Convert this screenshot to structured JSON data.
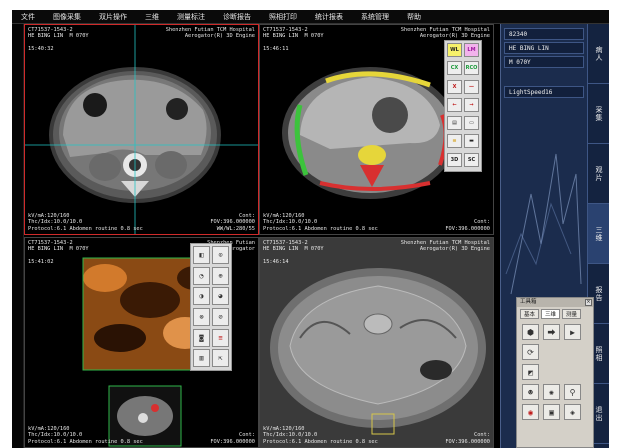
{
  "menu": [
    "文件",
    "图像采集",
    "双片操作",
    "三维",
    "测量标注",
    "诊断报告",
    "照相打印",
    "统计报表",
    "系统管理",
    "帮助"
  ],
  "viewports": {
    "vp1": {
      "top_left": "CT71537-1543-2\nHE BING LIN  M 070Y\n\n15:40:32",
      "top_right": "Shenzhen Futian TCM Hospital\nAerogator(R) 3D Engine",
      "bottom_left": "kV/mA:120/160\nThc/Idx:10.0/10.0\nProtocol:6.1 Abdomen routine 0.8 sec",
      "bottom_right": "Cont:\nFOV:396.000000\nWW/WL:280/55"
    },
    "vp2": {
      "top_left": "CT71537-1543-2\nHE BING LIN  M 070Y\n\n15:46:11",
      "top_right": "Shenzhen Futian TCM Hospital\nAerogator(R) 3D Engine",
      "bottom_left": "kV/mA:120/160\nThc/Idx:10.0/10.0\nProtocol:6.1 Abdomen routine 0.8 sec",
      "bottom_right": "Cont:\nFOV:396.000000"
    },
    "vp3": {
      "top_left": "CT71537-1543-2\nHE BING LIN  M 070Y\n\n15:41:02",
      "top_right": "Shenzhen Futian\nAerogator",
      "bottom_left": "kV/mA:120/160\nThc/Idx:10.0/10.0\nProtocol:6.1 Abdomen routine 0.8 sec",
      "bottom_right": "Cont:\nFOV:396.000000"
    },
    "vp4": {
      "top_left": "CT71537-1543-2\nHE BING LIN  M 070Y\n\n15:46:14",
      "top_right": "Shenzhen Futian TCM Hospital\nAerogator(R) 3D Engine",
      "bottom_left": "kV/mA:120/160\nThc/Idx:10.0/10.0\nProtocol:6.1 Abdomen routine 0.8 sec",
      "bottom_right": "Cont:\nFOV:396.000000"
    }
  },
  "tools2": [
    "WL",
    "LM",
    "CX",
    "RCO",
    "X",
    "—",
    "←",
    "→",
    "▤",
    "▭",
    "≡",
    "▬",
    "3D",
    "SC"
  ],
  "patient_panel": {
    "id": "82340",
    "name": "HE BING LIN",
    "sex_age": "M 070Y",
    "scanner": "LightSpeed16"
  },
  "side_tabs": [
    "病人",
    "采集",
    "观片",
    "三维",
    "报告",
    "照相",
    "退出"
  ],
  "palette": {
    "title": "工具箱",
    "tabs": [
      "基本",
      "三维",
      "测量"
    ],
    "active_tab": "三维"
  },
  "colors": {
    "active_border": "#d02a2a",
    "crosshair": "#22c4c4",
    "viewport_box": "#2fb84a",
    "sidebar_bg": "#1b2c4d"
  }
}
